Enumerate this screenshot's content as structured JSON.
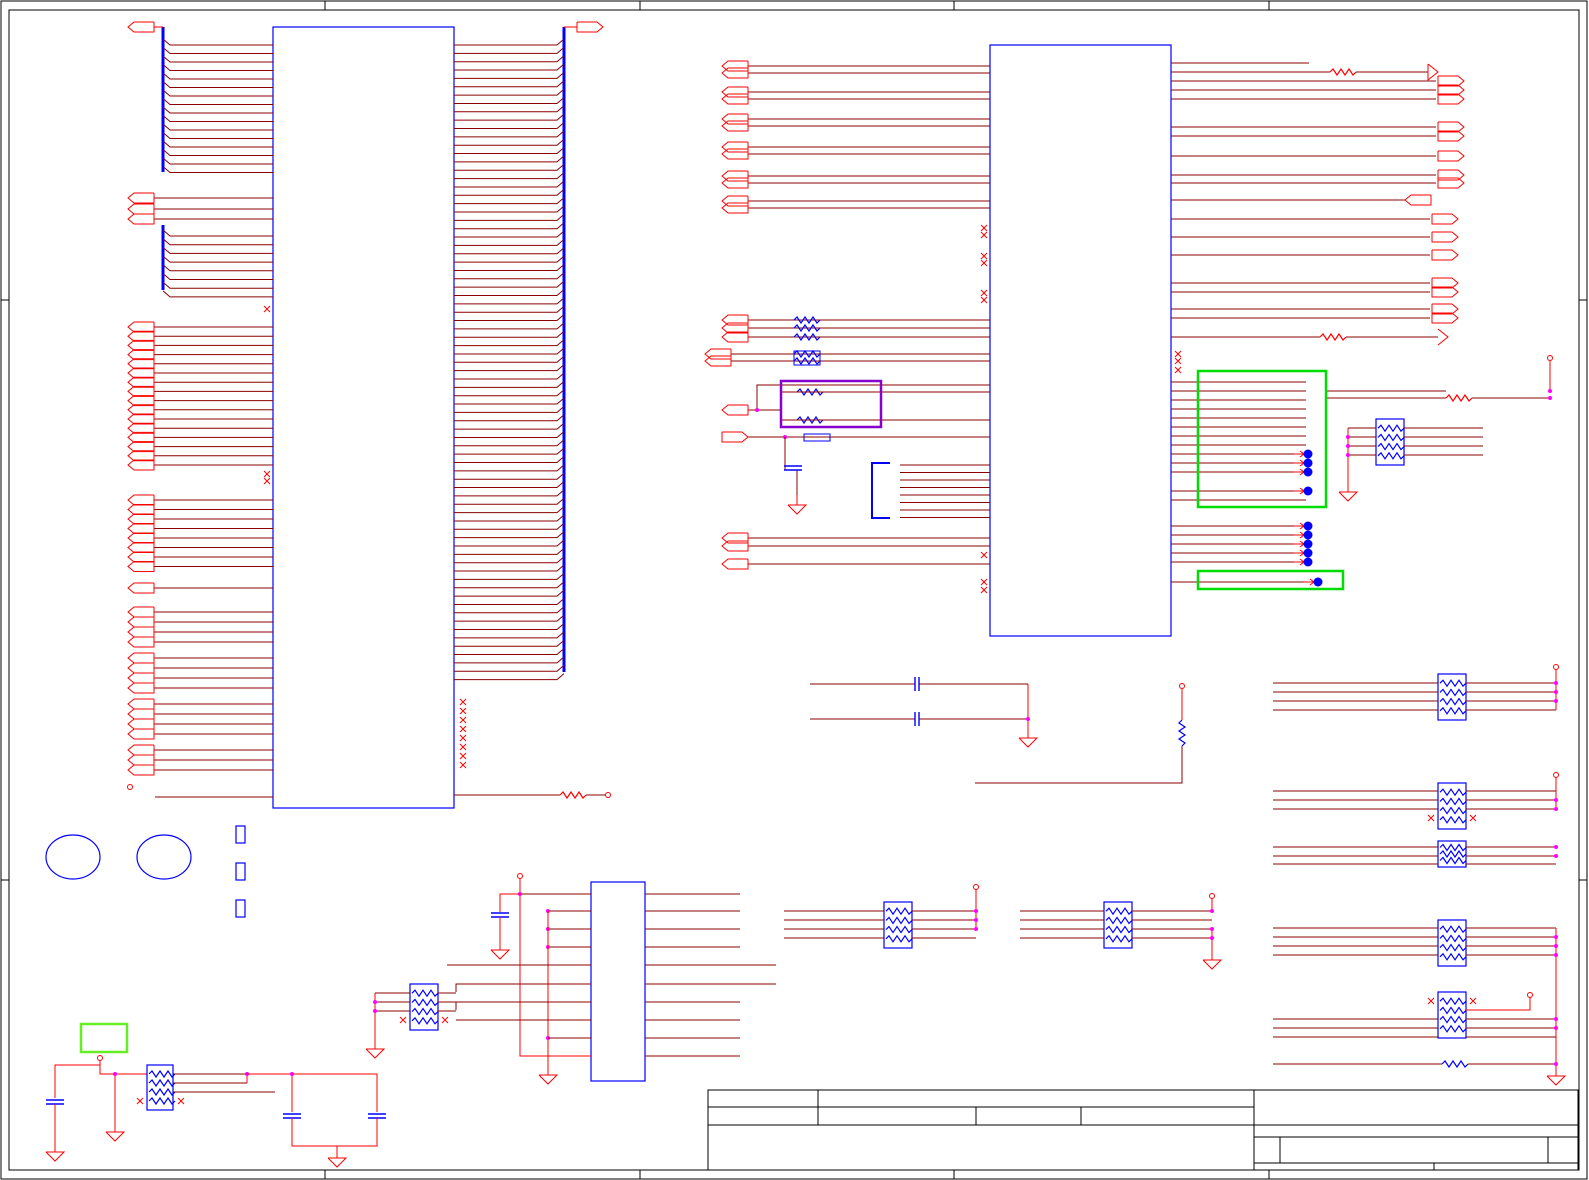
{
  "sheet": {
    "colors": {
      "wire": "#8b0000",
      "net": "#ff0000",
      "part": "#0000ff",
      "junction": "#ff00ff",
      "highlight_green": "#00dd00",
      "highlight_lime": "#66ee22",
      "highlight_purple": "#8800cc",
      "border": "#000000"
    },
    "title_block": {
      "title": "",
      "size": "",
      "document_number": "",
      "rev": "",
      "date": "",
      "sheet_of": ""
    }
  }
}
